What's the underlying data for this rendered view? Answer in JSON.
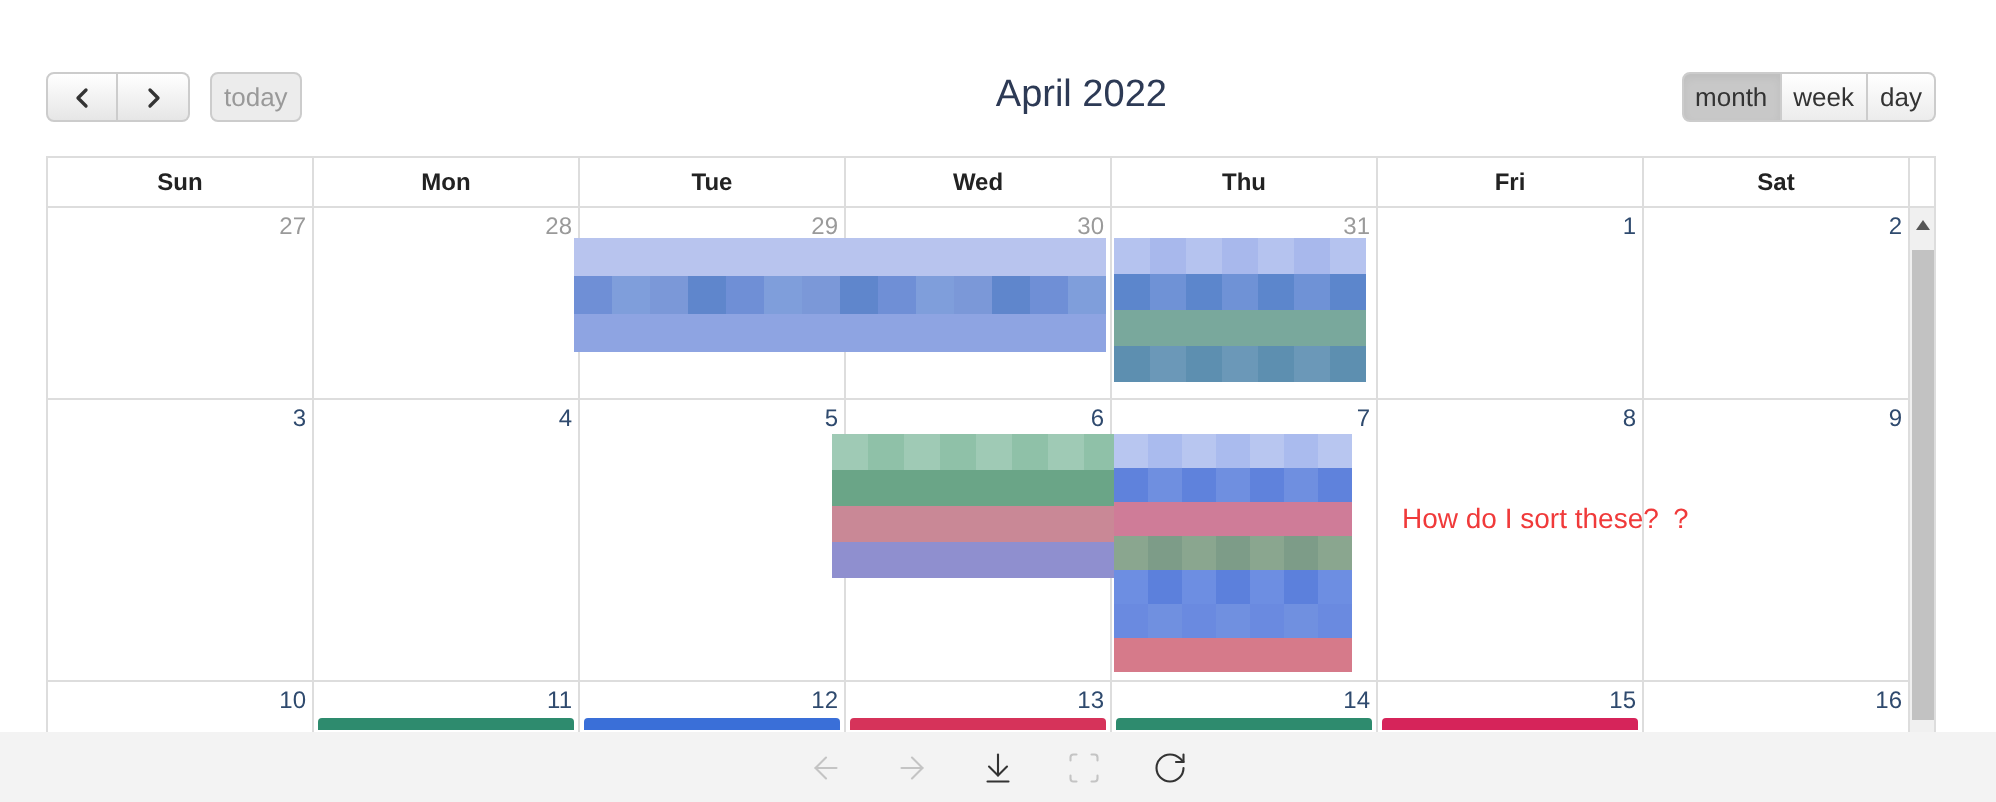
{
  "toolbar": {
    "today": {
      "label": "today",
      "disabled": true
    },
    "title": "April 2022",
    "views": [
      {
        "label": "month",
        "selected": true
      },
      {
        "label": "week",
        "selected": false
      },
      {
        "label": "day",
        "selected": false
      }
    ]
  },
  "weekdays": [
    "Sun",
    "Mon",
    "Tue",
    "Wed",
    "Thu",
    "Fri",
    "Sat"
  ],
  "weeks": [
    {
      "days": [
        {
          "number": "27",
          "other_month": true
        },
        {
          "number": "28",
          "other_month": true
        },
        {
          "number": "29",
          "other_month": true
        },
        {
          "number": "30",
          "other_month": true
        },
        {
          "number": "31",
          "other_month": true
        },
        {
          "number": "1",
          "other_month": false
        },
        {
          "number": "2",
          "other_month": false
        }
      ]
    },
    {
      "days": [
        {
          "number": "3",
          "other_month": false
        },
        {
          "number": "4",
          "other_month": false
        },
        {
          "number": "5",
          "other_month": false
        },
        {
          "number": "6",
          "other_month": false
        },
        {
          "number": "7",
          "other_month": false
        },
        {
          "number": "8",
          "other_month": false
        },
        {
          "number": "9",
          "other_month": false
        }
      ]
    },
    {
      "days": [
        {
          "number": "10",
          "other_month": false
        },
        {
          "number": "11",
          "other_month": false,
          "events": [
            {
              "color": "#2e8b6e"
            }
          ]
        },
        {
          "number": "12",
          "other_month": false,
          "events": [
            {
              "color": "#3a6fd8"
            }
          ]
        },
        {
          "number": "13",
          "other_month": false,
          "events": [
            {
              "color": "#d6335a"
            }
          ]
        },
        {
          "number": "14",
          "other_month": false,
          "events": [
            {
              "color": "#2e8b6e"
            }
          ]
        },
        {
          "number": "15",
          "other_month": false,
          "events": [
            {
              "color": "#d6245a"
            }
          ]
        },
        {
          "number": "16",
          "other_month": false
        }
      ]
    }
  ],
  "annotation": "How do I sort these? ？",
  "viewer_toolbar": [
    {
      "kind": "back",
      "disabled": true
    },
    {
      "kind": "forward",
      "disabled": true
    },
    {
      "kind": "download",
      "disabled": false
    },
    {
      "kind": "fit",
      "disabled": true
    },
    {
      "kind": "rotate",
      "disabled": false
    }
  ]
}
